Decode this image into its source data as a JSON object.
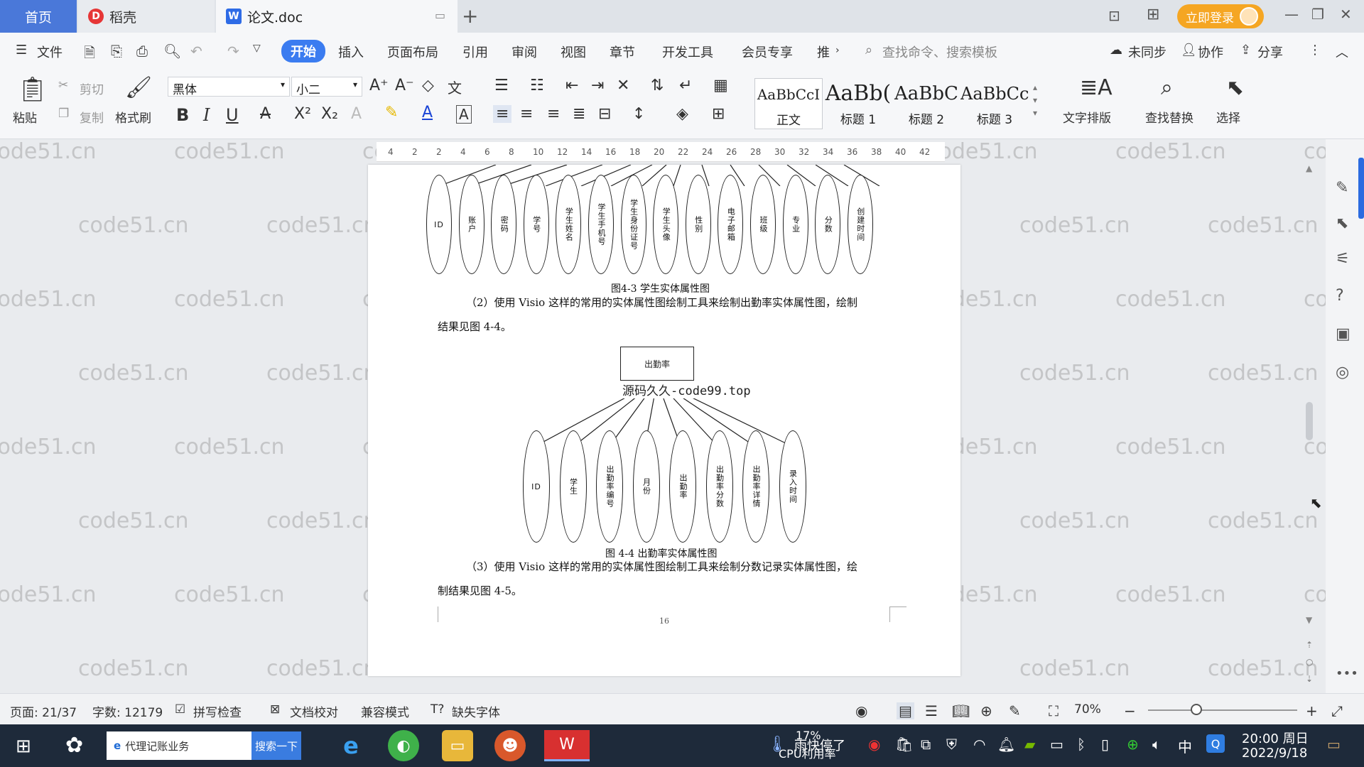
{
  "tabs": {
    "home": "首页",
    "daoke": "稻壳",
    "doc": "论文.doc"
  },
  "title_bar": {
    "login": "立即登录"
  },
  "menu": {
    "file": "文件",
    "items": [
      "开始",
      "插入",
      "页面布局",
      "引用",
      "审阅",
      "视图",
      "章节",
      "开发工具",
      "会员专享",
      "推"
    ],
    "search_cmd": "查找命令、搜索模板",
    "unsynced": "未同步",
    "collab": "协作",
    "share": "分享"
  },
  "ribbon": {
    "paste": "粘贴",
    "cut": "剪切",
    "copy": "复制",
    "format_painter": "格式刷",
    "font_name": "黑体",
    "font_size": "小二",
    "styles": [
      {
        "preview": "AaBbCcI",
        "label": "正文"
      },
      {
        "preview": "AaBb(",
        "label": "标题 1"
      },
      {
        "preview": "AaBbC",
        "label": "标题 2"
      },
      {
        "preview": "AaBbCc",
        "label": "标题 3"
      }
    ],
    "text_layout": "文字排版",
    "find_replace": "查找替换",
    "select": "选择"
  },
  "ruler": {
    "ticks": [
      "4",
      "2",
      "2",
      "4",
      "6",
      "8",
      "10",
      "12",
      "14",
      "16",
      "18",
      "20",
      "22",
      "24",
      "26",
      "28",
      "30",
      "32",
      "34",
      "36",
      "38",
      "40",
      "42"
    ]
  },
  "document": {
    "fig3_attrs": [
      "ID",
      "账户",
      "密码",
      "学号",
      "学生姓名",
      "学生手机号",
      "学生身份证号",
      "学生头像",
      "性别",
      "电子邮箱",
      "班级",
      "专业",
      "分数",
      "创建时间"
    ],
    "fig3_caption": "图4-3 学生实体属性图",
    "para2_line1": "（2）使用 Visio 这样的常用的实体属性图绘制工具来绘制出勤率实体属性图，绘制",
    "para2_line2": "结果见图 4-4。",
    "fig4_entity": "出勤率",
    "source_note": "源码久久-code99.top",
    "fig4_attrs": [
      "ID",
      "学生",
      "出勤率编号",
      "月份",
      "出勤率",
      "出勤率分数",
      "出勤率详情",
      "录入时间"
    ],
    "fig4_caption": "图 4-4 出勤率实体属性图",
    "para3_line1": "（3）使用 Visio 这样的常用的实体属性图绘制工具来绘制分数记录实体属性图，绘",
    "para3_line2": "制结果见图 4-5。",
    "page_number": "16",
    "watermark": "code51.cn"
  },
  "status_bar": {
    "page": "页面: 21/37",
    "words": "字数: 12179",
    "spell_check": "拼写检查",
    "doc_proof": "文档校对",
    "compat": "兼容模式",
    "missing_font": "缺失字体",
    "zoom": "70%"
  },
  "taskbar": {
    "search_text": "代理记账业务",
    "search_btn": "搜索一下",
    "cpu_percent": "17%",
    "cpu_label": "CPU利用率",
    "weather": "雨快停了",
    "ime": "中",
    "time": "20:00 周日",
    "date": "2022/9/18"
  },
  "colors": {
    "accent": "#3b7cf0",
    "home_tab": "#4a78d9",
    "login": "#f5a623",
    "taskbar": "#1e2a3a"
  }
}
